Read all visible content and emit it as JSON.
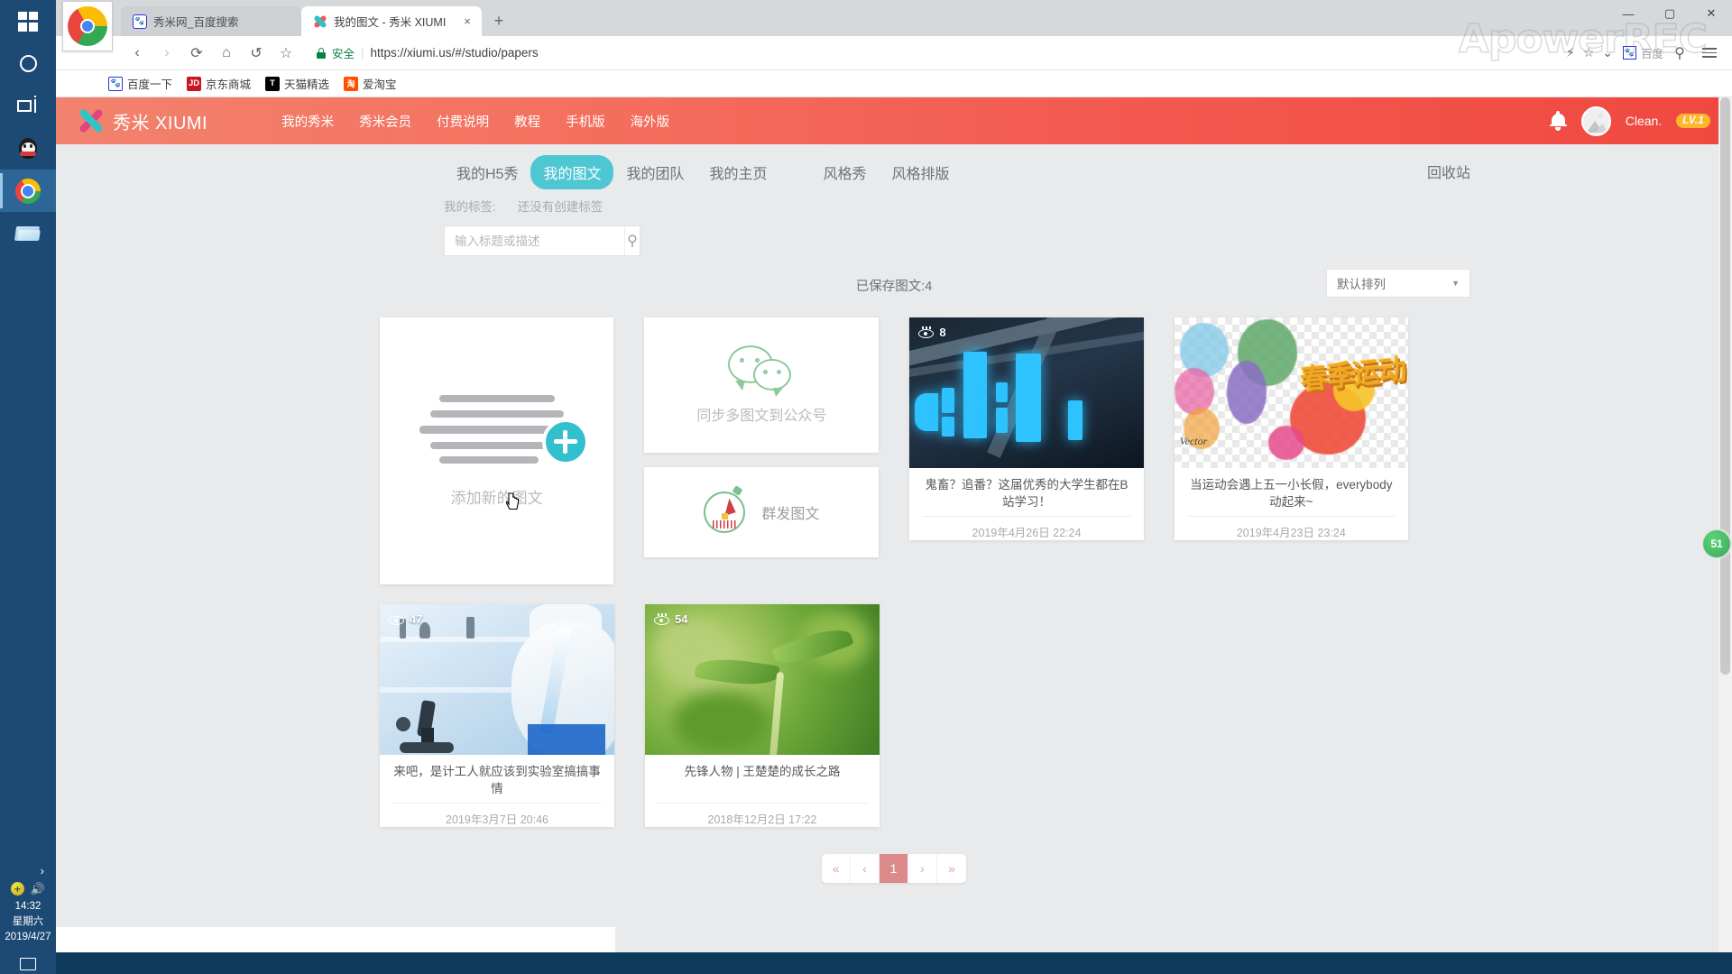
{
  "taskbar": {
    "items": [
      {
        "name": "start",
        "icon": "windows-logo-icon"
      },
      {
        "name": "cortana",
        "icon": "cortana-circle-icon"
      },
      {
        "name": "task-view",
        "icon": "task-view-icon"
      },
      {
        "name": "qq",
        "icon": "qq-penguin-icon"
      },
      {
        "name": "chrome",
        "icon": "chrome-icon"
      },
      {
        "name": "explorer",
        "icon": "folder-icon"
      }
    ],
    "tray": {
      "time": "14:32",
      "weekday": "星期六",
      "date": "2019/4/27"
    }
  },
  "browser": {
    "tabs": [
      {
        "title": "秀米网_百度搜索",
        "favicon": "baidu-icon",
        "active": false
      },
      {
        "title": "我的图文 - 秀米 XIUMI",
        "favicon": "xiumi-icon",
        "active": true
      }
    ],
    "new_tab_label": "+",
    "close_label": "×",
    "window_controls": {
      "minimize": "—",
      "maximize": "▢",
      "close": "✕"
    },
    "nav": {
      "back": "‹",
      "forward": "›",
      "reload": "⟳",
      "home": "⌂",
      "undo": "↺",
      "bookmark": "☆"
    },
    "omnibox": {
      "security_label": "安全",
      "url": "https://xiumi.us/#/studio/papers",
      "url_protocol": "https://",
      "url_host": "xiumi.us",
      "url_path": "/#/studio/papers",
      "flash_icon": "lightning-icon",
      "star_icon": "star-icon",
      "chevron_icon": "chevron-down-icon",
      "search_engine": "百度",
      "search_icon": "search-icon",
      "menu_icon": "hamburger-menu-icon"
    },
    "bookmarks": [
      {
        "label": "百度一下",
        "icon": "baidu-icon",
        "badge": ""
      },
      {
        "label": "京东商城",
        "icon": "jd-icon",
        "badge": "JD"
      },
      {
        "label": "天猫精选",
        "icon": "tmall-icon",
        "badge": "T"
      },
      {
        "label": "爱淘宝",
        "icon": "taobao-icon",
        "badge": "淘"
      }
    ]
  },
  "watermark": "ApowerREC",
  "xiumi": {
    "brand": "秀米 XIUMI",
    "nav": [
      "我的秀米",
      "秀米会员",
      "付费说明",
      "教程",
      "手机版",
      "海外版"
    ],
    "user": {
      "name": "Clean.",
      "level": "LV.1",
      "bell_icon": "bell-icon",
      "avatar_icon": "avatar-placeholder-icon"
    },
    "tabs": [
      {
        "label": "我的H5秀",
        "selected": false
      },
      {
        "label": "我的图文",
        "selected": true
      },
      {
        "label": "我的团队",
        "selected": false
      },
      {
        "label": "我的主页",
        "selected": false
      },
      {
        "label": "风格秀",
        "selected": false
      },
      {
        "label": "风格排版",
        "selected": false
      }
    ],
    "recycle_bin": "回收站",
    "tags": {
      "label": "我的标签:",
      "empty_text": "还没有创建标签"
    },
    "search": {
      "placeholder": "输入标题或描述",
      "value": "",
      "icon": "search-icon"
    },
    "saved_count_text": "已保存图文:4",
    "sort": {
      "selected": "默认排列",
      "caret": "▼"
    },
    "add_card": {
      "label": "添加新的图文",
      "plus_icon": "plus-circle-icon"
    },
    "wechat_card": {
      "label": "同步多图文到公众号",
      "icon": "wechat-icon"
    },
    "group_card": {
      "label": "群发图文",
      "icon": "timer-icon"
    },
    "posts": [
      {
        "title": "鬼畜？追番？这届优秀的大学生都在B站学习！",
        "date": "2019年4月26日 22:24",
        "views": "8",
        "thumb": "bilibili-neon-sign"
      },
      {
        "title": "当运动会遇上五一小长假，everybody动起来~",
        "date": "2019年4月23日 23:24",
        "views": "",
        "thumb": "spring-sports-poster"
      },
      {
        "title": "来吧，是计工人就应该到实验室搞搞事情",
        "date": "2019年3月7日 20:46",
        "views": "47",
        "thumb": "laboratory-microscope"
      },
      {
        "title": "先锋人物 | 王楚楚的成长之路",
        "date": "2018年12月2日 17:22",
        "views": "54",
        "thumb": "green-sprout"
      }
    ],
    "pagination": {
      "first": "«",
      "prev": "‹",
      "pages": [
        "1"
      ],
      "next": "›",
      "last": "»",
      "current": "1"
    },
    "float_badge": "51",
    "colors": {
      "header_start": "#f2836e",
      "header_end": "#f0483f",
      "tab_active": "#4ec7d3",
      "plus_button": "#32bfce",
      "pager_active": "#dd8a8a",
      "level_badge": "#ffb629"
    }
  }
}
